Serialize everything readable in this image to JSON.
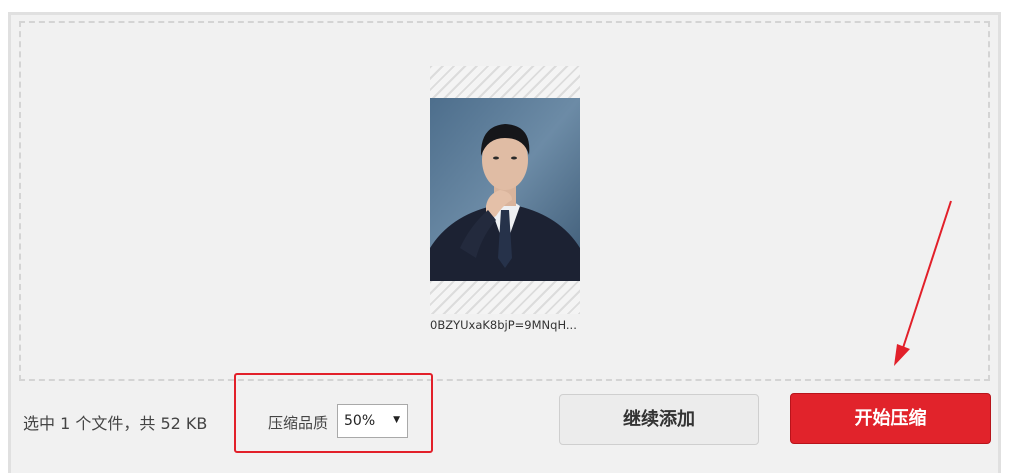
{
  "upload": {
    "file_name": "0BZYUxaK8bjP=9MNqH..."
  },
  "footer": {
    "summary": "选中 1 个文件，共 52 KB",
    "quality_label": "压缩品质",
    "quality_value": "50%",
    "add_more_label": "继续添加",
    "start_label": "开始压缩"
  },
  "colors": {
    "accent": "#e1232b",
    "annotation": "#e2202a"
  },
  "icons": {
    "select_caret": "caret-down-icon",
    "annotation_arrow": "red-arrow-icon"
  }
}
